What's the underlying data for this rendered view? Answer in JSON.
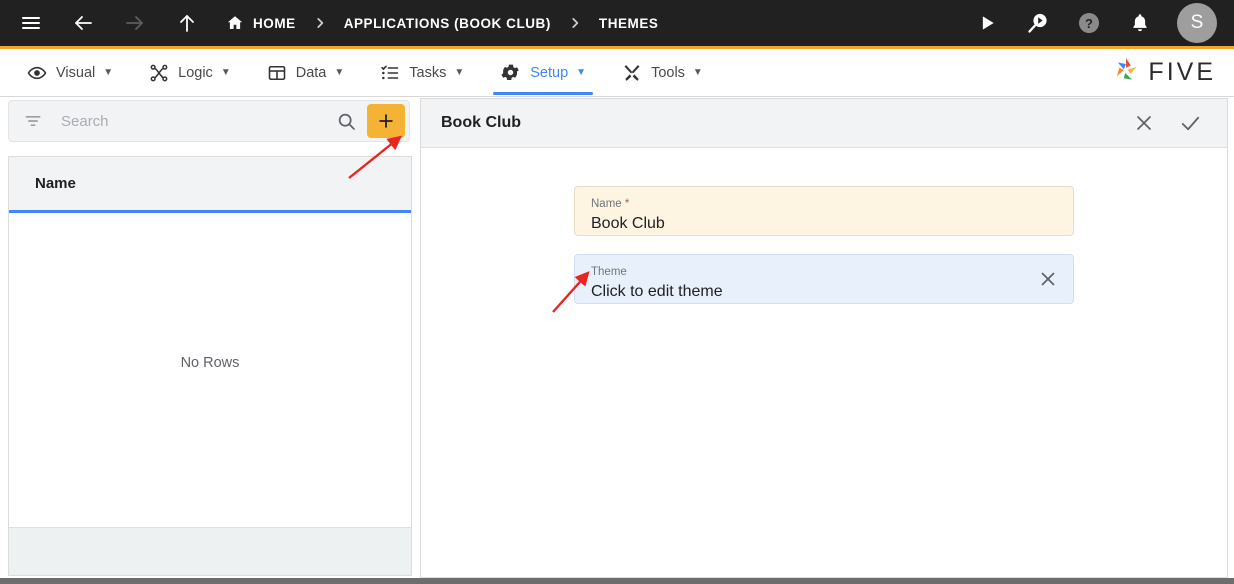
{
  "topbar": {
    "icons": [
      {
        "name": "hamburger-menu-icon",
        "label": "Menu"
      },
      {
        "name": "back-arrow-icon",
        "label": "Back"
      },
      {
        "name": "forward-arrow-icon",
        "label": "Forward"
      },
      {
        "name": "up-arrow-icon",
        "label": "Up"
      }
    ],
    "breadcrumbs": [
      {
        "label": "HOME",
        "icon": "home-icon"
      },
      {
        "label": "APPLICATIONS (BOOK CLUB)",
        "icon": ""
      },
      {
        "label": "THEMES",
        "icon": ""
      }
    ],
    "separator": "›",
    "right_icons": [
      {
        "name": "run-play-icon",
        "label": "Run"
      },
      {
        "name": "debug-search-play-icon",
        "label": "Debug"
      },
      {
        "name": "help-circle-icon",
        "label": "Help"
      },
      {
        "name": "bell-notification-icon",
        "label": "Notifications"
      }
    ],
    "avatar_initial": "S",
    "background": "#212121"
  },
  "menubar": {
    "accent_top": "#f0a82c",
    "active_color": "#4285f4",
    "items": [
      {
        "label": "Visual",
        "icon": "eye-icon",
        "active": false
      },
      {
        "label": "Logic",
        "icon": "flow-nodes-icon",
        "active": false
      },
      {
        "label": "Data",
        "icon": "table-grid-icon",
        "active": false
      },
      {
        "label": "Tasks",
        "icon": "checklist-icon",
        "active": false
      },
      {
        "label": "Setup",
        "icon": "gear-icon",
        "active": true
      },
      {
        "label": "Tools",
        "icon": "wrench-screwdriver-icon",
        "active": false
      }
    ],
    "caret": "▼",
    "brand": "FIVE"
  },
  "left_panel": {
    "search": {
      "placeholder": "Search",
      "value": "",
      "filter_icon": "filter-icon",
      "search_icon": "search-icon"
    },
    "add_button": {
      "label": "+",
      "color": "#f5b335"
    },
    "columns": [
      "Name"
    ],
    "rows": [],
    "empty_text": "No Rows",
    "header_underline": "#4285f4"
  },
  "right_panel": {
    "title": "Book Club",
    "actions": [
      {
        "name": "close-button",
        "icon": "close-x-icon"
      },
      {
        "name": "confirm-button",
        "icon": "check-icon"
      }
    ],
    "fields": [
      {
        "label": "Name",
        "required_mark": " *",
        "value": "Book Club",
        "background": "#fdf5e2",
        "has_clear": false
      },
      {
        "label": "Theme",
        "required_mark": "",
        "value": "Click to edit theme",
        "background": "#e8f1fb",
        "has_clear": true
      }
    ]
  },
  "annotations": [
    {
      "name": "arrow-to-add-button",
      "color": "#e8251f"
    },
    {
      "name": "arrow-to-theme-field",
      "color": "#e8251f"
    }
  ]
}
